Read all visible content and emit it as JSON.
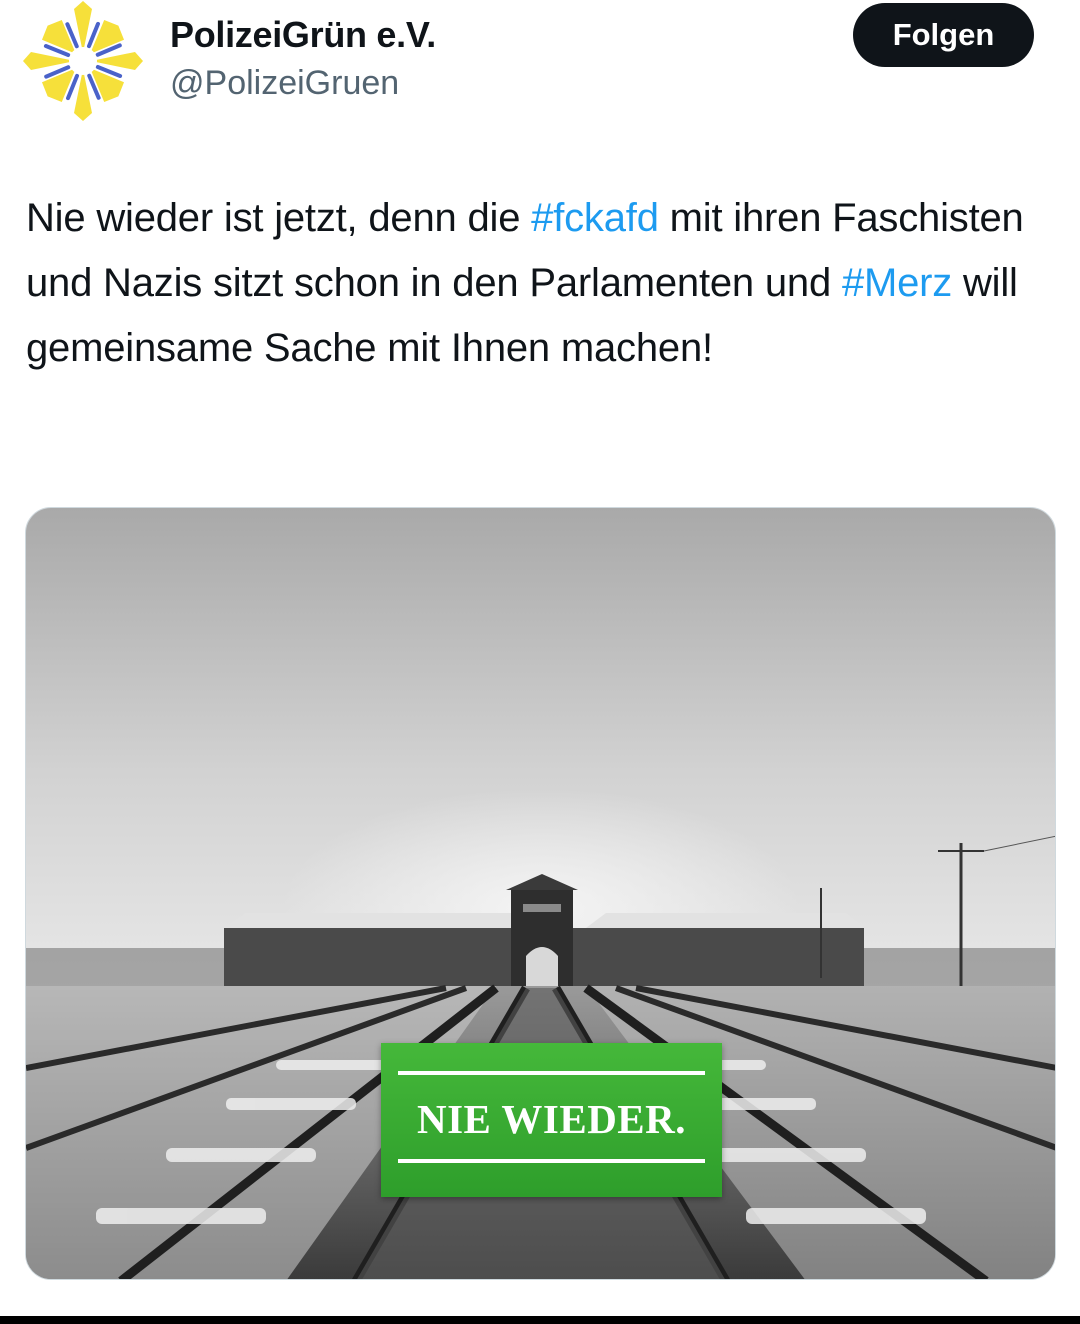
{
  "author": {
    "display_name": "PolizeiGrün e.V.",
    "handle": "@PolizeiGruen",
    "avatar_icon": "sun-star-logo-icon",
    "avatar_colors": [
      "#f6e03a",
      "#4a62c9"
    ]
  },
  "follow_button": {
    "label": "Folgen"
  },
  "tweet": {
    "text_parts": [
      "Nie wieder ist jetzt, denn die ",
      "#fckafd",
      " mit ihren Faschisten und Nazis sitzt schon in den Parlamenten und ",
      "#Merz",
      " will gemeinsame Sache mit Ihnen machen!"
    ]
  },
  "media": {
    "description_icon": "photo-railway-tracks-icon",
    "overlay_badge": {
      "text": "NIE WIEDER.",
      "color": "#3aa935"
    }
  },
  "colors": {
    "text": "#0f1419",
    "secondary": "#536471",
    "link": "#1d9bf0",
    "button_bg": "#0f1419",
    "button_fg": "#ffffff"
  }
}
